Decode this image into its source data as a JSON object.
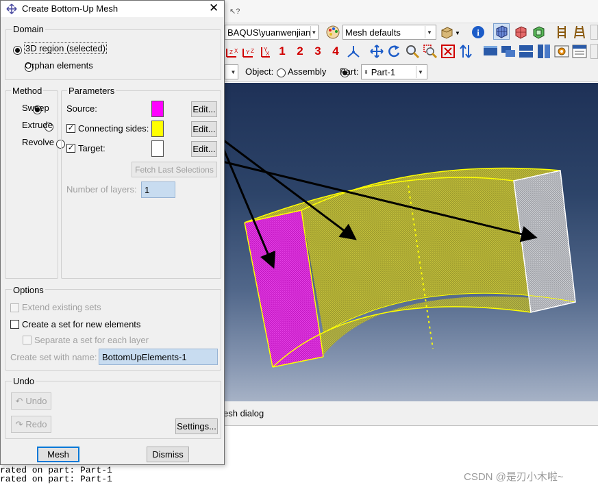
{
  "dialog": {
    "title": "Create Bottom-Up Mesh",
    "domain": {
      "label": "Domain",
      "options": [
        "3D region (selected)",
        "Orphan elements"
      ],
      "selected": 0
    },
    "method": {
      "label": "Method",
      "options": [
        "Sweep",
        "Extrude",
        "Revolve"
      ],
      "selected": 0
    },
    "parameters": {
      "label": "Parameters",
      "source_label": "Source:",
      "source_color": "#ff00ff",
      "connecting_label": "Connecting sides:",
      "connecting_checked": true,
      "connecting_color": "#ffff00",
      "target_label": "Target:",
      "target_checked": true,
      "target_color": "#ffffff",
      "edit_label": "Edit...",
      "fetch_label": "Fetch Last Selections",
      "layers_label": "Number of layers:",
      "layers_value": "1"
    },
    "options": {
      "label": "Options",
      "extend_label": "Extend existing sets",
      "create_set_label": "Create a set for new elements",
      "separate_label": "Separate a set for each layer",
      "set_name_label": "Create set with name:",
      "set_name_value": "BottomUpElements-1"
    },
    "undo": {
      "label": "Undo",
      "undo_label": "Undo",
      "redo_label": "Redo",
      "settings_label": "Settings..."
    },
    "mesh_button": "Mesh",
    "dismiss_button": "Dismiss"
  },
  "app": {
    "model_combo": "BAQUS\\yuanwenjian",
    "mesh_defaults_combo": "Mesh defaults",
    "digits": [
      "1",
      "2",
      "3",
      "4"
    ],
    "object_label": "Object:",
    "assembly_label": "Assembly",
    "part_label": "Part:",
    "part_value": "Part-1",
    "prompt_text": "esh dialog",
    "messages": [
      "rated on part: Part-1",
      "rated on part: Part-1"
    ],
    "watermark": "CSDN @是刃小木啦~"
  },
  "colors": {
    "source_face": "#ff00ff",
    "side_faces": "#ffff00",
    "target_face": "#ffffff",
    "viewport_top": "#1e3157",
    "viewport_bottom": "#a6b2c6"
  }
}
